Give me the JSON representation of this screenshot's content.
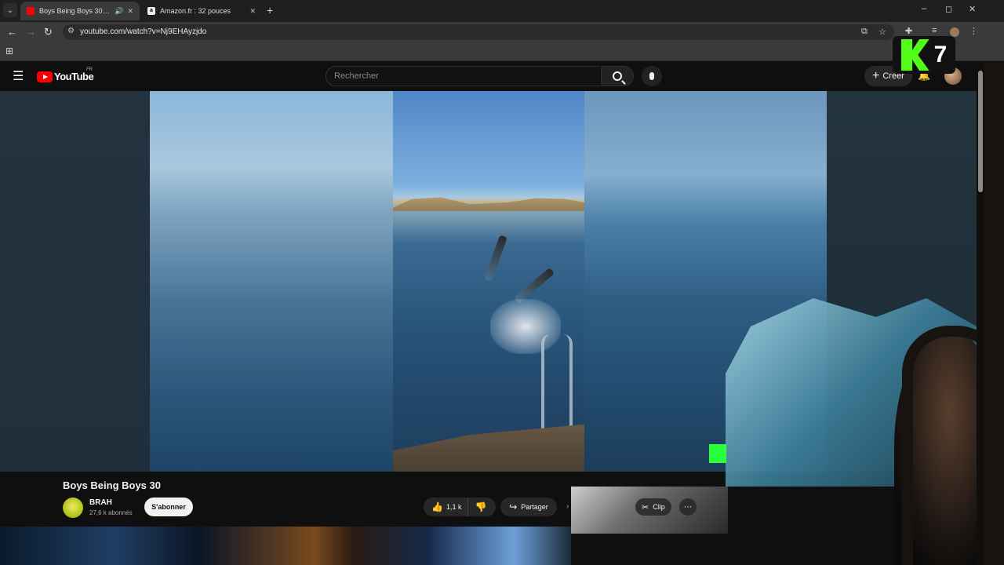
{
  "browser": {
    "tabs": [
      {
        "title": "Boys Being Boys 30 - YouTube",
        "active": true,
        "favicon": "youtube-icon"
      },
      {
        "title": "Amazon.fr : 32 pouces",
        "active": false,
        "favicon": "amazon-icon"
      }
    ],
    "url": "youtube.com/watch?v=Nj9EHAyzjdo",
    "window_controls": {
      "minimize": "–",
      "maximize": "◻",
      "close": "✕"
    }
  },
  "youtube": {
    "logo_text": "YouTube",
    "country_code": "FR",
    "search_placeholder": "Rechercher",
    "create_label": "Créer"
  },
  "video": {
    "title": "Boys Being Boys 30",
    "channel_name": "BRAH",
    "subscriber_count": "27,6 k abonnés",
    "subscribe_label": "S'abonner",
    "like_count": "1,1 k",
    "share_label": "Partager",
    "clip_label": "Clip"
  },
  "overlay": {
    "badge_number": "7",
    "brand_color": "#53fc18"
  },
  "colors": {
    "yt_red": "#ff0000",
    "background": "#0f0f0f"
  }
}
